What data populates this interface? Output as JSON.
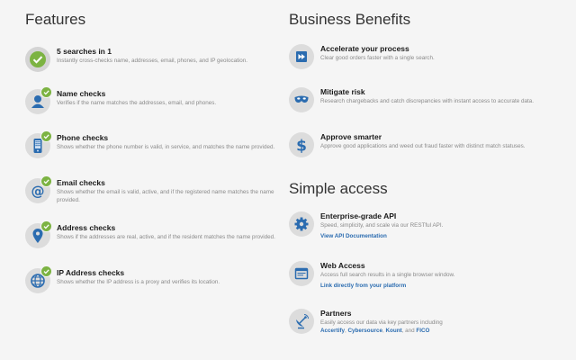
{
  "features": {
    "title": "Features",
    "items": [
      {
        "title": "5 searches in 1",
        "desc": "Instantly cross-checks name, addresses, email, phones, and IP geolocation."
      },
      {
        "title": "Name checks",
        "desc": "Verifies if the name matches the addresses, email, and phones."
      },
      {
        "title": "Phone checks",
        "desc": "Shows whether the phone number is valid, in service, and matches the name provided."
      },
      {
        "title": "Email checks",
        "desc": "Shows whether the email is valid, active, and if the registered name matches the name provided."
      },
      {
        "title": "Address checks",
        "desc": "Shows if the addresses are real, active, and if the resident matches the name provided."
      },
      {
        "title": "IP Address checks",
        "desc": "Shows whether the IP address is a proxy and verifies its location."
      }
    ]
  },
  "benefits": {
    "title": "Business Benefits",
    "items": [
      {
        "title": "Accelerate your process",
        "desc": "Clear good orders faster with a single search."
      },
      {
        "title": "Mitigate risk",
        "desc": "Research chargebacks and catch discrepancies with instant access to accurate data."
      },
      {
        "title": "Approve smarter",
        "desc": "Approve good applications and weed out fraud faster with distinct match statuses."
      }
    ]
  },
  "access": {
    "title": "Simple access",
    "items": [
      {
        "title": "Enterprise-grade API",
        "desc": "Speed, simplicity, and scale via our RESTful API.",
        "link": "View API Documentation"
      },
      {
        "title": "Web Access",
        "desc": "Access full search results in a single browser window.",
        "link": "Link directly from your platform"
      },
      {
        "title": "Partners",
        "desc": "Easily access our data via key partners including",
        "partners": [
          "Accertify",
          "Cybersource",
          "Kount",
          "FICO"
        ],
        "sep1": ", ",
        "sep2": ", ",
        "sep3": ", and "
      }
    ]
  },
  "colors": {
    "accent_green": "#7cb342",
    "icon_blue": "#2b6cb0",
    "icon_bg": "#dcdcdc"
  }
}
